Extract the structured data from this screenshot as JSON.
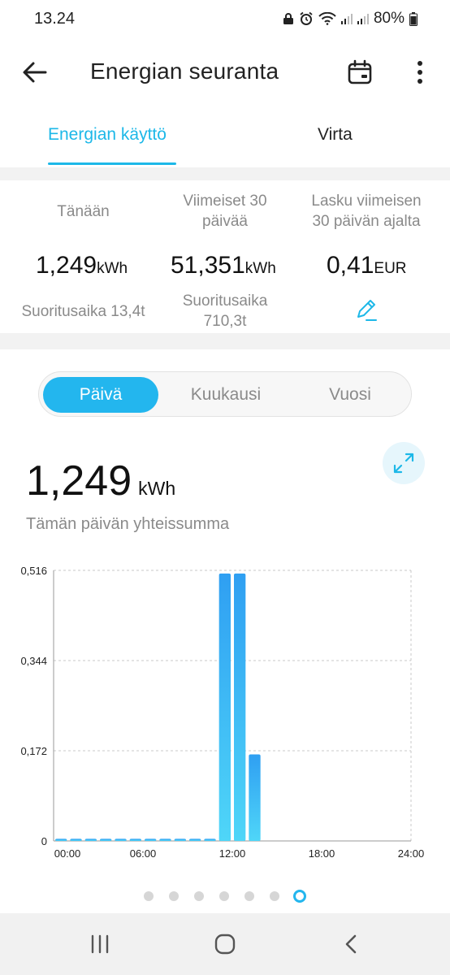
{
  "status_bar": {
    "time": "13.24",
    "battery": "80%"
  },
  "app_bar": {
    "title": "Energian seuranta"
  },
  "tabs": [
    {
      "label": "Energian käyttö",
      "active": true
    },
    {
      "label": "Virta",
      "active": false
    }
  ],
  "summary": {
    "today": {
      "label": "Tänään",
      "value": "1,249",
      "unit": "kWh",
      "runtime": "Suoritusaika 13,4t"
    },
    "last30": {
      "label_line1": "Viimeiset 30",
      "label_line2": "päivää",
      "value": "51,351",
      "unit": "kWh",
      "runtime_line1": "Suoritusaika",
      "runtime_line2": "710,3t"
    },
    "bill": {
      "label_line1": "Lasku viimeisen",
      "label_line2": "30 päivän ajalta",
      "value": "0,41",
      "unit": "EUR"
    }
  },
  "period_selector": {
    "options": [
      "Päivä",
      "Kuukausi",
      "Vuosi"
    ],
    "selected": "Päivä"
  },
  "total": {
    "value": "1,249",
    "unit": "kWh",
    "caption": "Tämän päivän yhteissumma"
  },
  "colors": {
    "accent": "#1db8e8",
    "bar_top": "#2f9ff2",
    "bar_bottom": "#4fd6f8"
  },
  "chart_data": {
    "type": "bar",
    "x_tick_labels": [
      "00:00",
      "06:00",
      "12:00",
      "18:00",
      "24:00"
    ],
    "y_tick_labels": [
      "0",
      "0,172",
      "0,344",
      "0,516"
    ],
    "ylim": [
      0,
      0.516
    ],
    "grid": true,
    "categories": [
      "00",
      "01",
      "02",
      "03",
      "04",
      "05",
      "06",
      "07",
      "08",
      "09",
      "10",
      "11",
      "12",
      "13",
      "14",
      "15",
      "16",
      "17",
      "18",
      "19",
      "20",
      "21",
      "22",
      "23"
    ],
    "values": [
      0.004,
      0.004,
      0.004,
      0.004,
      0.004,
      0.004,
      0.004,
      0.004,
      0.004,
      0.004,
      0.004,
      0.51,
      0.51,
      0.165,
      0,
      0,
      0,
      0,
      0,
      0,
      0,
      0,
      0,
      0
    ],
    "unit": "kWh"
  },
  "pager": {
    "count": 7,
    "active_index": 6
  },
  "icons": {
    "back": "arrow-left-icon",
    "calendar": "calendar-icon",
    "more": "more-vertical-icon",
    "edit": "pencil-icon",
    "expand": "expand-icon",
    "nav_recents": "recents-icon",
    "nav_home": "home-icon",
    "nav_back": "chevron-left-icon"
  }
}
